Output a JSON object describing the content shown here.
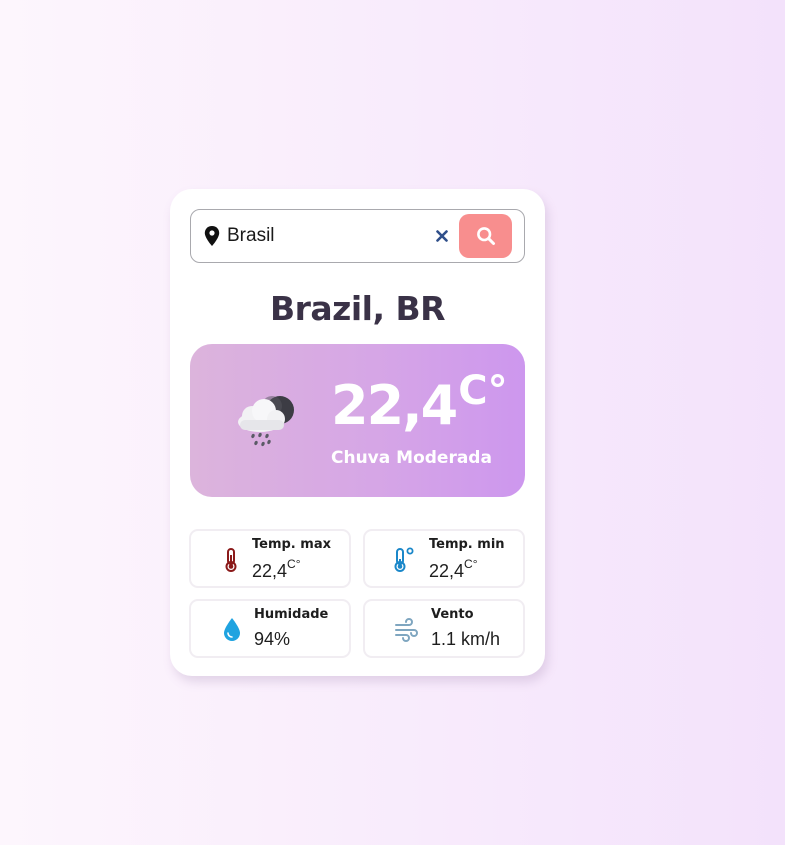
{
  "search": {
    "value": "Brasil",
    "placeholder": "",
    "clear_icon": "close-icon",
    "button_icon": "search-icon",
    "button_color": "#f88e8e"
  },
  "location": {
    "title": "Brazil, BR"
  },
  "current": {
    "temperature": "22,4",
    "unit": "C°",
    "description": "Chuva Moderada",
    "icon": "cloud-rain-moon-icon",
    "card_gradient": [
      "#dcb4dc",
      "#cd97ee"
    ]
  },
  "details": {
    "temp_max": {
      "label": "Temp. max",
      "value": "22,4",
      "unit": "C°",
      "icon": "thermometer-hot-icon",
      "color": "#8b1a1a"
    },
    "temp_min": {
      "label": "Temp. min",
      "value": "22,4",
      "unit": "C°",
      "icon": "thermometer-cold-icon",
      "color": "#1a87c9"
    },
    "humidity": {
      "label": "Humidade",
      "value": "94%",
      "icon": "water-drop-icon",
      "color": "#1fa3e0"
    },
    "wind": {
      "label": "Vento",
      "value": "1.1 km/h",
      "icon": "wind-icon",
      "color": "#7fa6c0"
    }
  }
}
